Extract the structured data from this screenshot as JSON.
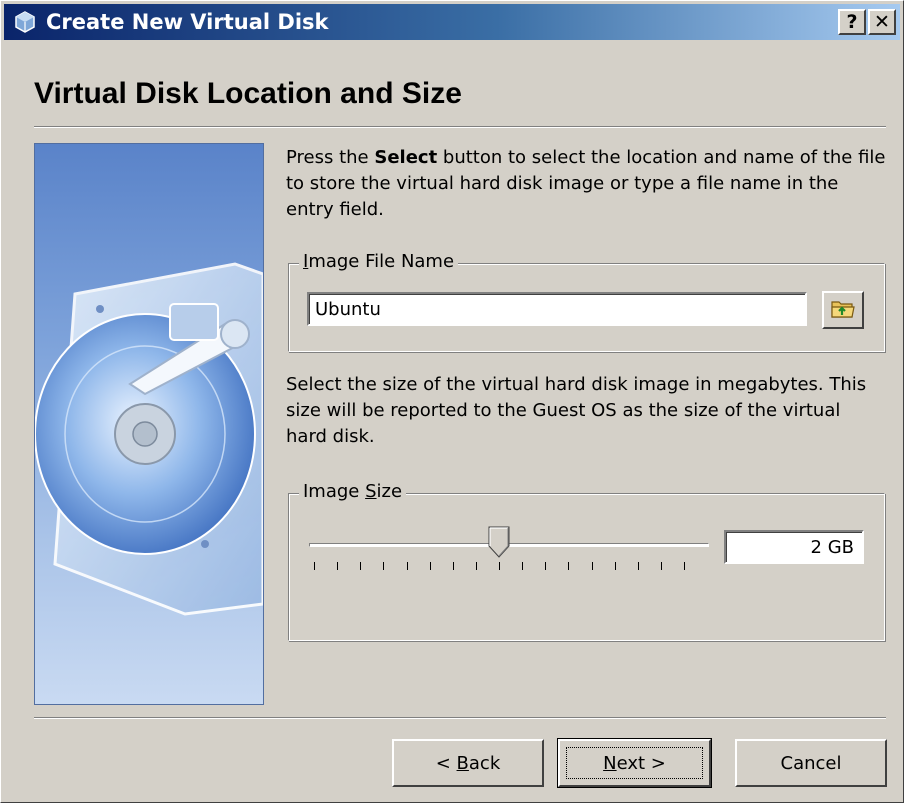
{
  "window": {
    "title": "Create New Virtual Disk",
    "title_icon": "virtualbox-icon",
    "help_button": "?",
    "close_button": "✕"
  },
  "page": {
    "heading": "Virtual Disk Location and Size"
  },
  "location": {
    "description_before": "Press the ",
    "description_bold": "Select",
    "description_after": " button to select the location and name of the file to store the virtual hard disk image or type a file name in the entry field.",
    "group_label_mnemonic": "I",
    "group_label_rest": "mage File Name",
    "file_name_value": "Ubuntu",
    "select_button_icon": "folder-icon"
  },
  "size": {
    "description": "Select the size of the virtual hard disk image in megabytes. This size will be reported to the Guest OS as the size of the virtual hard disk.",
    "group_label_before": "Image ",
    "group_label_mnemonic": "S",
    "group_label_after": "ize",
    "slider_fraction": 0.5,
    "tick_count": 17,
    "size_value": "2 GB"
  },
  "buttons": {
    "back_prefix": "< ",
    "back_mnemonic": "B",
    "back_rest": "ack",
    "next_mnemonic": "N",
    "next_rest": "ext >",
    "cancel": "Cancel"
  },
  "colors": {
    "titlebar_start": "#0a246a",
    "titlebar_end": "#a6caf0",
    "dialog_face": "#d4d0c8",
    "side_panel_top": "#5a83c9"
  }
}
